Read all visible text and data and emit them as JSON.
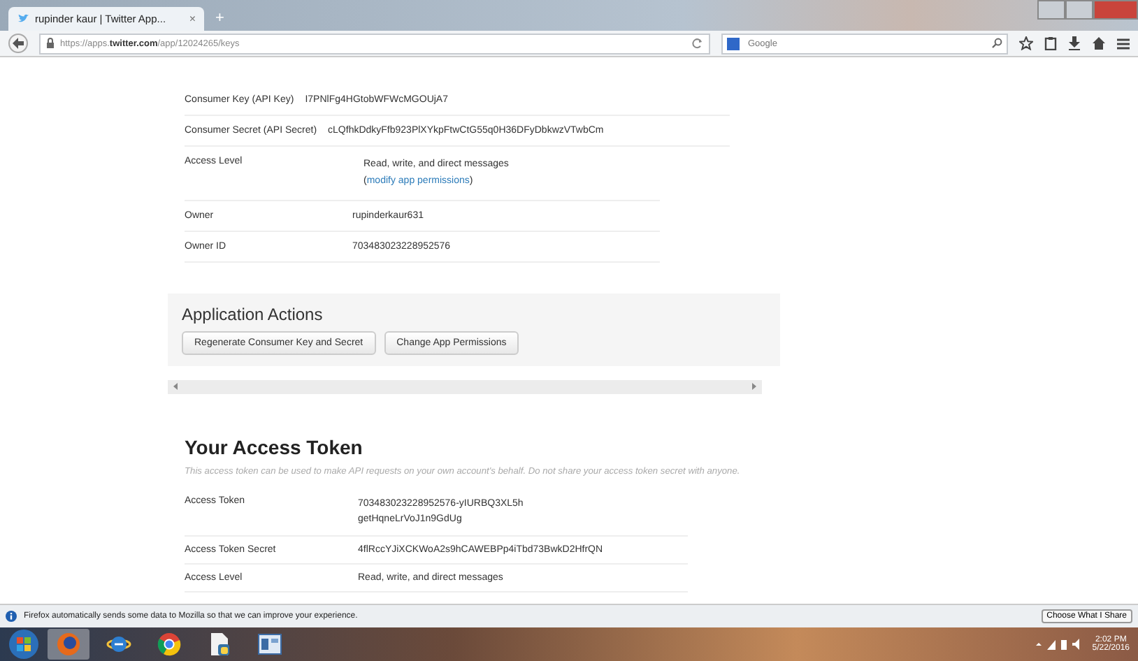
{
  "browser": {
    "tab": {
      "title": "rupinder kaur | Twitter App...",
      "close": "×",
      "selected": true
    },
    "new_tab": "+",
    "url": "https://apps.**twitter.com**/app/12024265/keys",
    "search": {
      "placeholder": "Google"
    }
  },
  "app_details": [
    {
      "label": "Consumer Key (API Key)",
      "value": "I7PNlFg4HGtobWFWcMGOUjA7"
    },
    {
      "label": "Consumer Secret (API Secret)",
      "value": "cLQfhkDdkyFfb923PlXYkpFtwCtG55q0H36DFyDbkwzVTwbCm"
    },
    {
      "label": "Access Level",
      "value": "Read, write, and direct messages (",
      "link": "modify app permissions",
      "after": ")"
    },
    {
      "label": "Owner",
      "value": "rupinderkaur631"
    },
    {
      "label": "Owner ID",
      "value": "703483023228952576"
    }
  ],
  "application_actions": {
    "title": "Application Actions",
    "buttons": [
      "Regenerate Consumer Key and Secret",
      "Change App Permissions"
    ]
  },
  "access_token": {
    "title": "Your Access Token",
    "description": "This access token can be used to make API requests on your own account's behalf. Do not share your access token secret with anyone.",
    "rows": [
      {
        "label": "Access Token",
        "value": "703483023228952576-yIURBQ3XL5hgetHqneLrVoJ1n9GdUg"
      },
      {
        "label": "Access Token Secret",
        "value": "4flRccYJiXCKWoA2s9hCAWEBPp4iTbd73BwkD2HfrQN"
      },
      {
        "label": "Access Level",
        "value": "Read, write, and direct messages"
      }
    ]
  },
  "notification": {
    "text": "Firefox automatically sends some data to Mozilla so that we can improve your experience.",
    "button": "Choose What I Share"
  },
  "taskbar": {
    "time": "2:02 PM",
    "date": "5/22/2016"
  }
}
